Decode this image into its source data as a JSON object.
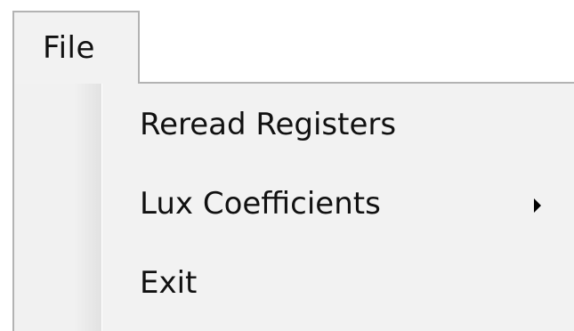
{
  "menubar": {
    "file_label": "File"
  },
  "file_menu": {
    "items": [
      {
        "label": "Reread Registers",
        "has_submenu": false
      },
      {
        "label": "Lux Coefficients",
        "has_submenu": true
      },
      {
        "label": "Exit",
        "has_submenu": false
      }
    ]
  },
  "icons": {
    "submenu": "chevron-right-icon"
  },
  "colors": {
    "menu_background": "#f2f2f2",
    "border": "#b3b3b3",
    "text": "#111111"
  }
}
